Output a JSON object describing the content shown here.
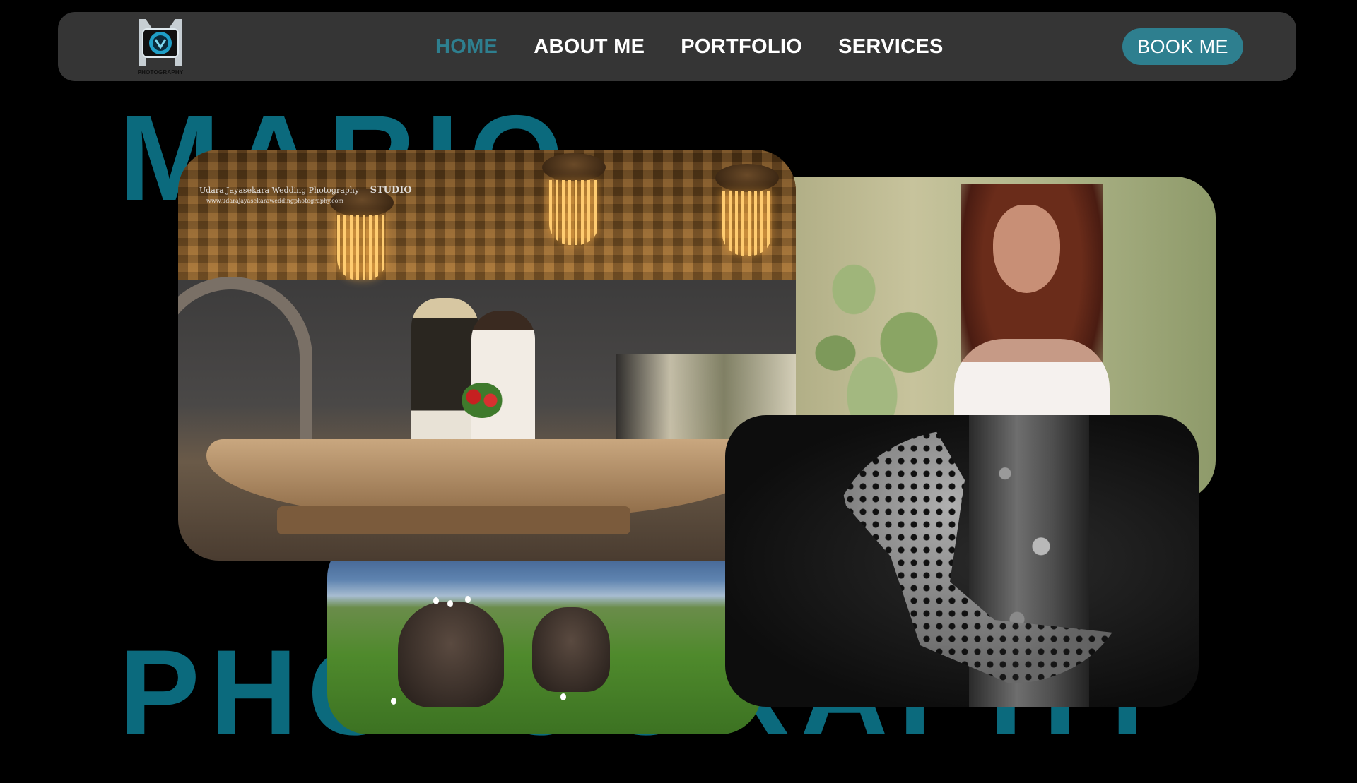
{
  "brand": {
    "logo_icon": "camera-logo-icon",
    "logo_text": "PHOTOGRAPHY",
    "accent_color": "#2e7f8f"
  },
  "nav": {
    "links": [
      {
        "label": "HOME",
        "active": true
      },
      {
        "label": "ABOUT ME",
        "active": false
      },
      {
        "label": "PORTFOLIO",
        "active": false
      },
      {
        "label": "SERVICES",
        "active": false
      }
    ],
    "cta": "BOOK ME"
  },
  "hero": {
    "word_top": "MARIO",
    "word_bottom": "PHOTOGRAPHY",
    "color": "#0b6a7d"
  },
  "gallery": {
    "wedding_watermark": "Udara Jayasekara Wedding Photography",
    "wedding_watermark_url": "www.udarajayasekaraweddingphotography.com",
    "wedding_studio": "STUDIO"
  }
}
